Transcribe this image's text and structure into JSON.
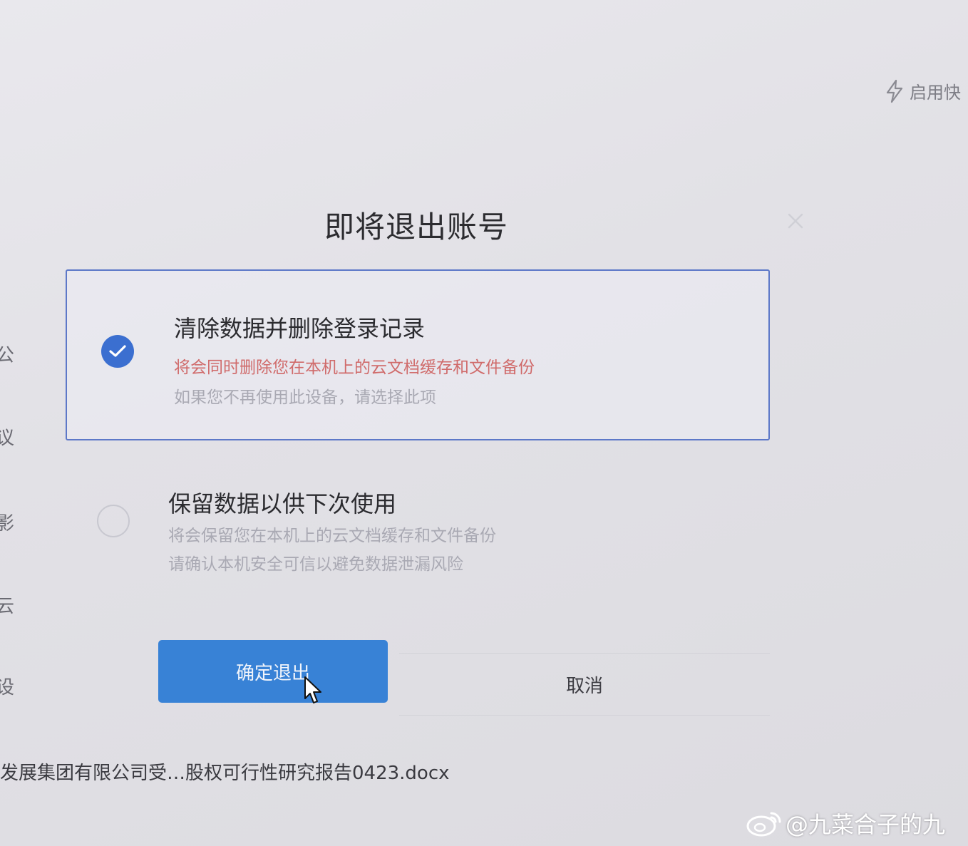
{
  "top_bar": {
    "quick_label": "启用快",
    "quick_icon": "lightning-icon"
  },
  "sidebar": {
    "fragments": [
      "公",
      "议",
      "影",
      "云",
      "设"
    ]
  },
  "dialog": {
    "title": "即将退出账号",
    "close_icon": "close-icon",
    "options": [
      {
        "title": "清除数据并删除登录记录",
        "warning": "将会同时删除您在本机上的云文档缓存和文件备份",
        "hint": "如果您不再使用此设备，请选择此项",
        "selected": true
      },
      {
        "title": "保留数据以供下次使用",
        "line1": "将会保留您在本机上的云文档缓存和文件备份",
        "line2": "请确认本机安全可信以避免数据泄漏风险",
        "selected": false
      }
    ],
    "confirm_label": "确定退出",
    "cancel_label": "取消"
  },
  "background": {
    "file_name": "发展集团有限公司受…股权可行性研究报告0423.docx"
  },
  "watermark": {
    "text": "@九菜合子的九"
  },
  "colors": {
    "accent": "#3882d6",
    "selected_border": "#5d78c8",
    "warning": "#d06b6b"
  }
}
